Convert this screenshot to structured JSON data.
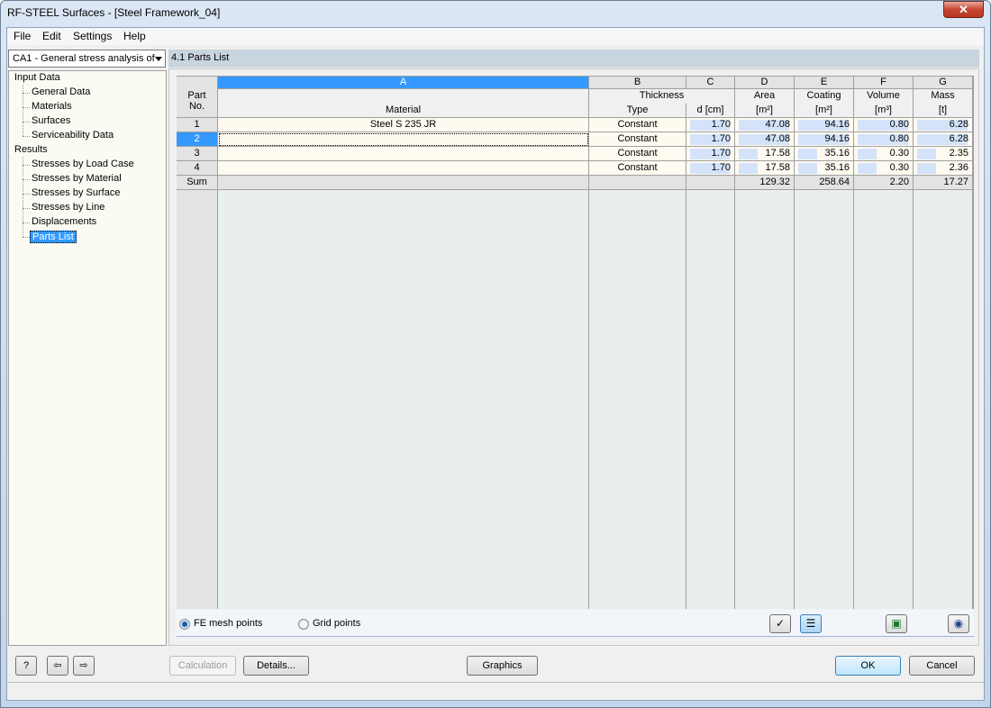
{
  "window": {
    "title": "RF-STEEL Surfaces - [Steel Framework_04]",
    "close": "✕"
  },
  "menu": [
    "File",
    "Edit",
    "Settings",
    "Help"
  ],
  "case_select": "CA1 - General stress analysis of",
  "tree": {
    "input_label": "Input Data",
    "input_items": [
      "General Data",
      "Materials",
      "Surfaces",
      "Serviceability Data"
    ],
    "results_label": "Results",
    "results_items": [
      "Stresses by Load Case",
      "Stresses by Material",
      "Stresses by Surface",
      "Stresses by Line",
      "Displacements",
      "Parts List"
    ],
    "selected": "Parts List"
  },
  "section_title": "4.1 Parts List",
  "table": {
    "col_letters": [
      "A",
      "B",
      "C",
      "D",
      "E",
      "F",
      "G"
    ],
    "rowhdr": [
      "Part",
      "No."
    ],
    "headers": {
      "a": "Material",
      "b_top": "Thickness",
      "b": "Type",
      "c": "d [cm]",
      "d_top": "Area",
      "d": "[m²]",
      "e_top": "Coating",
      "e": "[m²]",
      "f_top": "Volume",
      "f": "[m³]",
      "g_top": "Mass",
      "g": "[t]"
    },
    "rows": [
      {
        "no": "1",
        "material": "Steel S 235 JR",
        "type": "Constant",
        "d": "1.70",
        "area": "47.08",
        "coating": "94.16",
        "volume": "0.80",
        "mass": "6.28"
      },
      {
        "no": "2",
        "material": "",
        "type": "Constant",
        "d": "1.70",
        "area": "47.08",
        "coating": "94.16",
        "volume": "0.80",
        "mass": "6.28"
      },
      {
        "no": "3",
        "material": "",
        "type": "Constant",
        "d": "1.70",
        "area": "17.58",
        "coating": "35.16",
        "volume": "0.30",
        "mass": "2.35"
      },
      {
        "no": "4",
        "material": "",
        "type": "Constant",
        "d": "1.70",
        "area": "17.58",
        "coating": "35.16",
        "volume": "0.30",
        "mass": "2.36"
      }
    ],
    "sum": {
      "label": "Sum",
      "area": "129.32",
      "coating": "258.64",
      "volume": "2.20",
      "mass": "17.27"
    },
    "selected_row": "2"
  },
  "options": {
    "fe_mesh": "FE mesh points",
    "grid": "Grid points",
    "selected": "FE mesh points"
  },
  "buttons": {
    "calculation": "Calculation",
    "details": "Details...",
    "graphics": "Graphics",
    "ok": "OK",
    "cancel": "Cancel"
  },
  "colors": {
    "selection": "#3399ff",
    "row_bg": "#fffaf0",
    "bar": "#d4e3fa"
  }
}
